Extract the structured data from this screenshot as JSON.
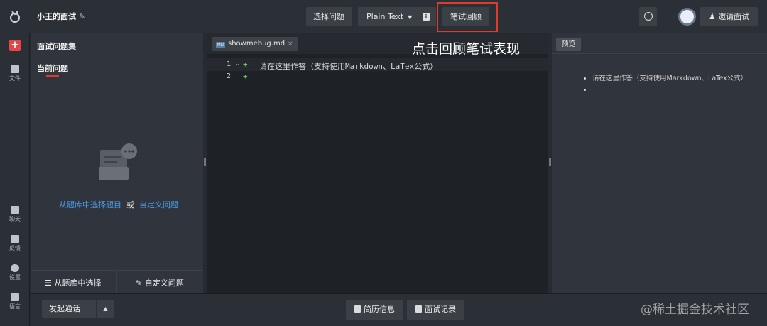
{
  "app": {
    "title": "小王的面试",
    "edit_icon": "pencil-icon"
  },
  "toolbar": {
    "select_question": "选择问题",
    "language": "Plain Text",
    "written_review": "笔试回顾",
    "invite": "邀请面试"
  },
  "rail": {
    "files": "文件",
    "chat": "聊天",
    "feedback": "反馈",
    "settings": "设置",
    "language": "语言"
  },
  "left_panel": {
    "question_set": "面试问题集",
    "current_question": "当前问题",
    "choose_from_bank_link": "从题库中选择题目",
    "or": "或",
    "custom_link": "自定义问题",
    "bottom_choose": "从题库中选择",
    "bottom_custom": "自定义问题"
  },
  "editor": {
    "tab_badge": "MD",
    "tab_name": "showmebug.md",
    "tab_close": "×",
    "lines": [
      {
        "number": "1",
        "marker": "+",
        "text": "请在这里作答（支持使用Markdown、LaTex公式）"
      },
      {
        "number": "2",
        "marker": "+",
        "text": ""
      }
    ]
  },
  "annotation": "点击回顾笔试表现",
  "preview": {
    "button": "预览",
    "items": [
      "请在这里作答（支持使用Markdown、LaTex公式）",
      ""
    ]
  },
  "bottom": {
    "start_call": "发起通话",
    "resume_info": "简历信息",
    "interview_record": "面试记录"
  },
  "watermark": "@稀土掘金技术社区",
  "colors": {
    "accent_red": "#e03a2a",
    "link_blue": "#4a9ee8",
    "diff_green": "#7fcf6a"
  }
}
